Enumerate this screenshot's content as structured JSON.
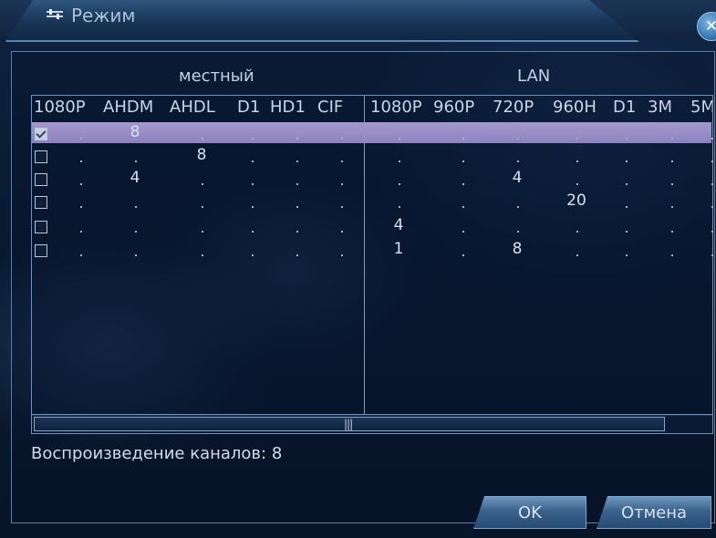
{
  "window": {
    "title": "Режим"
  },
  "groups": {
    "local": "местный",
    "lan": "LAN"
  },
  "columns": {
    "local": [
      "1080P",
      "AHDM",
      "AHDL",
      "D1",
      "HD1",
      "CIF"
    ],
    "lan": [
      "1080P",
      "960P",
      "720P",
      "960H",
      "D1",
      "3M",
      "5M"
    ]
  },
  "rows": [
    {
      "checked": true,
      "local": [
        "",
        "8",
        "",
        "",
        "",
        ""
      ],
      "lan": [
        "",
        "",
        "",
        "",
        "",
        "",
        ""
      ]
    },
    {
      "checked": false,
      "local": [
        "",
        "",
        "8",
        "",
        "",
        ""
      ],
      "lan": [
        "",
        "",
        "",
        "",
        "",
        "",
        ""
      ]
    },
    {
      "checked": false,
      "local": [
        "",
        "4",
        "",
        "",
        "",
        ""
      ],
      "lan": [
        "",
        "",
        "4",
        "",
        "",
        "",
        ""
      ]
    },
    {
      "checked": false,
      "local": [
        "",
        "",
        "",
        "",
        "",
        ""
      ],
      "lan": [
        "",
        "",
        "",
        "20",
        "",
        "",
        ""
      ]
    },
    {
      "checked": false,
      "local": [
        "",
        "",
        "",
        "",
        "",
        ""
      ],
      "lan": [
        "4",
        "",
        "",
        "",
        "",
        "",
        ""
      ]
    },
    {
      "checked": false,
      "local": [
        "",
        "",
        "",
        "",
        "",
        ""
      ],
      "lan": [
        "1",
        "",
        "8",
        "",
        "",
        "",
        ""
      ]
    }
  ],
  "status": {
    "text": "Воспроизведение каналов: 8"
  },
  "buttons": {
    "ok": "OK",
    "cancel": "Отмена"
  },
  "colors": {
    "selected_row": "#a798d6",
    "frame": "#5a7ea8",
    "accent": "#2f6fa8"
  }
}
